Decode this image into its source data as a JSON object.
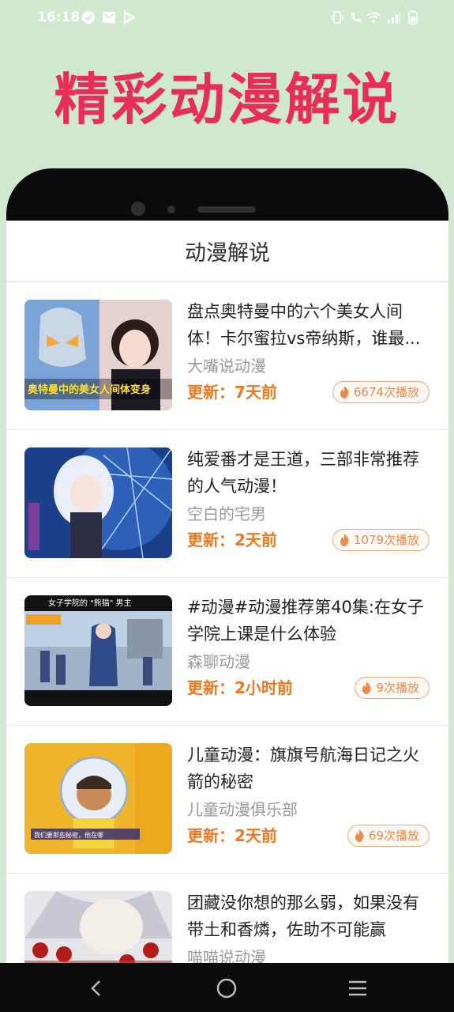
{
  "status_bar": {
    "time": "16:18",
    "icons_left": [
      "check-circle-icon",
      "mail-icon",
      "play-store-icon"
    ],
    "icons_right": [
      "vibrate-icon",
      "wifi-call-icon",
      "wifi-icon",
      "signal-icon",
      "battery-icon"
    ]
  },
  "banner": {
    "title": "精彩动漫解说"
  },
  "screen": {
    "header_title": "动漫解说"
  },
  "items": [
    {
      "title": "盘点奥特曼中的六个美女人间体！卡尔蜜拉vs帝纳斯，谁最...",
      "author": "大嘴说动漫",
      "update": "更新：7天前",
      "plays": "6674次播放",
      "thumb_text": "奥特曼中的美女人间体变身"
    },
    {
      "title": "纯爱番才是王道，三部非常推荐的人气动漫！",
      "author": "空白的宅男",
      "update": "更新：2天前",
      "plays": "1079次播放"
    },
    {
      "title": "#动漫#动漫推荐第40集:在女子学院上课是什么体验",
      "author": "森聊动漫",
      "update": "更新：2小时前",
      "plays": "9次播放",
      "thumb_text": "女子学院的 \"熊猫\" 男主"
    },
    {
      "title": "儿童动漫：旗旗号航海日记之火箭的秘密",
      "author": "儿童动漫俱乐部",
      "update": "更新：2天前",
      "plays": "69次播放",
      "thumb_text": "我们要那些秘密，他在哪"
    },
    {
      "title": "团藏没你想的那么弱，如果没有带土和香燐，佐助不可能赢",
      "author": "喵喵说动漫",
      "update": "",
      "plays": ""
    }
  ],
  "navbar": {
    "buttons": [
      "back-icon",
      "home-icon",
      "menu-icon"
    ]
  },
  "colors": {
    "background": "#cfe8cf",
    "banner_title": "#e62e56",
    "accent": "#f0771f",
    "frame": "#0b0b0b"
  }
}
